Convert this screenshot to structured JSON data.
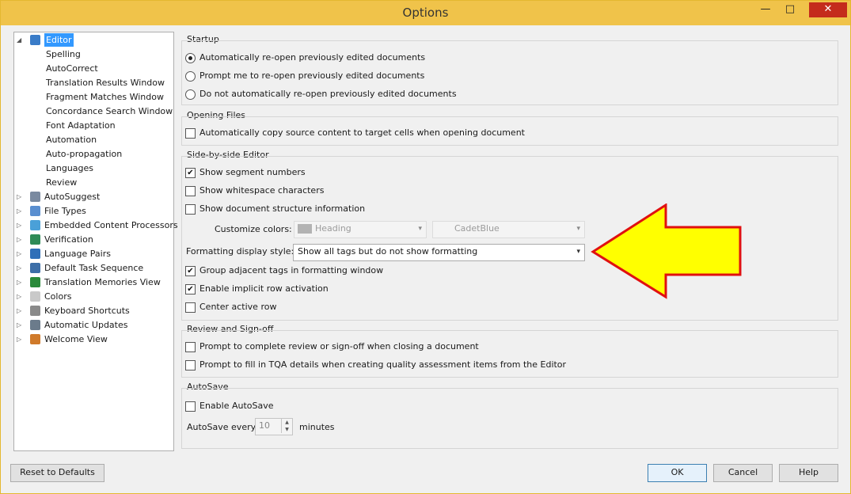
{
  "window": {
    "title": "Options",
    "minimize_glyph": "—",
    "maximize_glyph": "□",
    "close_glyph": "✕"
  },
  "tree": {
    "items": [
      {
        "label": "Editor",
        "level": 0,
        "expander": "◢",
        "icon": "pencil-icon",
        "icon_color": "#3a7cc8",
        "selected": true
      },
      {
        "label": "Spelling",
        "level": 1
      },
      {
        "label": "AutoCorrect",
        "level": 1
      },
      {
        "label": "Translation Results Window",
        "level": 1
      },
      {
        "label": "Fragment Matches Window",
        "level": 1
      },
      {
        "label": "Concordance Search Window",
        "level": 1
      },
      {
        "label": "Font Adaptation",
        "level": 1
      },
      {
        "label": "Automation",
        "level": 1
      },
      {
        "label": "Auto-propagation",
        "level": 1
      },
      {
        "label": "Languages",
        "level": 1
      },
      {
        "label": "Review",
        "level": 1
      },
      {
        "label": "AutoSuggest",
        "level": 0,
        "expander": "▷",
        "icon": "autosuggest-icon",
        "icon_color": "#7a8aa0"
      },
      {
        "label": "File Types",
        "level": 0,
        "expander": "▷",
        "icon": "file-types-icon",
        "icon_color": "#5a8fd0"
      },
      {
        "label": "Embedded Content Processors",
        "level": 0,
        "expander": "▷",
        "icon": "embedded-content-icon",
        "icon_color": "#4aa0d8"
      },
      {
        "label": "Verification",
        "level": 0,
        "expander": "▷",
        "icon": "verification-icon",
        "icon_color": "#2e8b57"
      },
      {
        "label": "Language Pairs",
        "level": 0,
        "expander": "▷",
        "icon": "globe-icon",
        "icon_color": "#2f6fb8"
      },
      {
        "label": "Default Task Sequence",
        "level": 0,
        "expander": "▷",
        "icon": "task-sequence-icon",
        "icon_color": "#3d6fa8"
      },
      {
        "label": "Translation Memories View",
        "level": 0,
        "expander": "▷",
        "icon": "translation-memory-icon",
        "icon_color": "#2a8a3a"
      },
      {
        "label": "Colors",
        "level": 0,
        "expander": "▷",
        "icon": "palette-icon",
        "icon_color": "#c9c9c9"
      },
      {
        "label": "Keyboard Shortcuts",
        "level": 0,
        "expander": "▷",
        "icon": "keyboard-icon",
        "icon_color": "#8a8a8a"
      },
      {
        "label": "Automatic Updates",
        "level": 0,
        "expander": "▷",
        "icon": "updates-icon",
        "icon_color": "#6b7b8b"
      },
      {
        "label": "Welcome View",
        "level": 0,
        "expander": "▷",
        "icon": "home-icon",
        "icon_color": "#d07a2a"
      }
    ]
  },
  "startup": {
    "title": "Startup",
    "options": [
      {
        "label": "Automatically re-open previously edited documents",
        "checked": true
      },
      {
        "label": "Prompt me to re-open previously edited documents",
        "checked": false
      },
      {
        "label": "Do not automatically re-open previously edited documents",
        "checked": false
      }
    ]
  },
  "opening_files": {
    "title": "Opening Files",
    "copy_source": {
      "label": "Automatically copy source content to target cells when opening document",
      "checked": false
    }
  },
  "side_by_side": {
    "title": "Side-by-side Editor",
    "show_segment_numbers": {
      "label": "Show segment numbers",
      "checked": true
    },
    "show_whitespace": {
      "label": "Show whitespace characters",
      "checked": false
    },
    "show_structure": {
      "label": "Show document structure information",
      "checked": false
    },
    "customize_colors_label": "Customize colors:",
    "color_a": "Heading",
    "color_b": "CadetBlue",
    "formatting_label": "Formatting display style:",
    "formatting_value": "Show all tags but do not show formatting",
    "group_tags": {
      "label": "Group adjacent tags in formatting window",
      "checked": true
    },
    "implicit_row": {
      "label": "Enable implicit row activation",
      "checked": true
    },
    "center_row": {
      "label": "Center active row",
      "checked": false
    }
  },
  "review": {
    "title": "Review and Sign-off",
    "prompt_complete": {
      "label": "Prompt to complete review or sign-off when closing a document",
      "checked": false
    },
    "prompt_tqa": {
      "label": "Prompt to fill in TQA details when creating quality assessment items from the Editor",
      "checked": false
    }
  },
  "autosave": {
    "title": "AutoSave",
    "enable": {
      "label": "Enable AutoSave",
      "checked": false
    },
    "every_label": "AutoSave every",
    "every_value": "10",
    "minutes_label": "minutes"
  },
  "buttons": {
    "reset": "Reset to Defaults",
    "ok": "OK",
    "cancel": "Cancel",
    "help": "Help"
  },
  "colors": {
    "titlebar": "#f0c34a",
    "selection": "#3399ff",
    "arrow_fill": "#ffff00",
    "arrow_stroke": "#e01010"
  },
  "glyphs": {
    "check": "✔",
    "dropdown": "▾"
  }
}
